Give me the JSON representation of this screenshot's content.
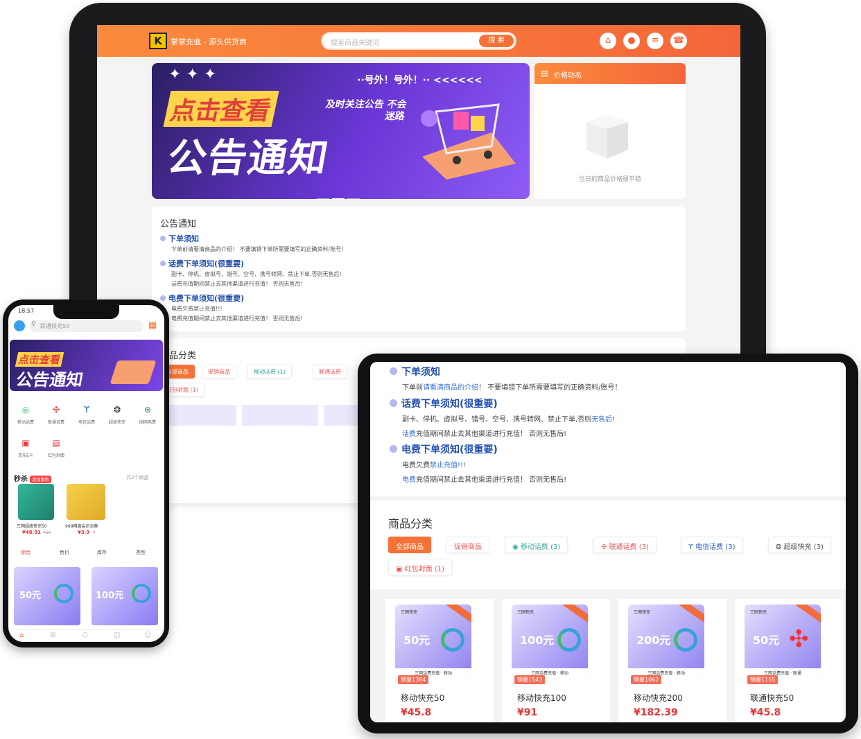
{
  "laptop": {
    "site_name": "掌掌充值 - 源头供货商",
    "logo_letter": "K",
    "search_placeholder": "搜索商品关键词",
    "search_button": "搜 索",
    "banner": {
      "top_text": "··号外！号外！·· <<<<<<",
      "headline": "点击查看",
      "subline": "及时关注公告 不会迷路",
      "big_title": "公告通知"
    },
    "price_card": {
      "title": "价格动态",
      "empty_note": "当日的商品价格很平稳"
    },
    "notice": {
      "title": "公告通知",
      "items": [
        {
          "title": "下单须知",
          "lines": [
            "下单前请看清商品的介绍！ 不要填错下单所需要填写的正确资料/账号！"
          ]
        },
        {
          "title": "话费下单须知(很重要)",
          "lines": [
            "副卡、停机、虚拟号、错号、空号、携号转网、禁止下单,否则无售后!",
            "话费充值期间禁止去其他渠道进行充值！ 否则无售后!"
          ]
        },
        {
          "title": "电费下单须知(很重要)",
          "lines": [
            "电费欠费禁止充值!!!",
            "电费充值期间禁止去其他渠道进行充值！ 否则无售后!"
          ]
        }
      ]
    },
    "category_title": "商品分类",
    "chips": [
      "全部商品",
      "促销商品",
      "移动话费 (1)",
      "联通话费"
    ],
    "chip_row2": "红包封面 (1)"
  },
  "phone": {
    "time": "18:57",
    "search_placeholder": "联通快充50",
    "icons": [
      "移动话费",
      "联通话费",
      "电信话费",
      "超级快充",
      "国网电费",
      "京东E卡",
      "红包封面"
    ],
    "seckill_title": "秒杀",
    "seckill_badge": "超值限购",
    "seckill_count": "共2个商品",
    "seckill_items": [
      {
        "name": "三网超级快充50",
        "price": "¥48.91",
        "old": "¥50"
      },
      {
        "name": "999网盘会员合集",
        "price": "¥3.9",
        "old": "¥"
      }
    ],
    "sorts": [
      "综合",
      "售价",
      "库存",
      "类型"
    ],
    "products": [
      {
        "amount": "50元"
      },
      {
        "amount": "100元"
      }
    ],
    "tabbar": [
      "首页",
      "分类",
      "订单",
      "购物车",
      "我的"
    ]
  },
  "tablet": {
    "notice": [
      {
        "title": "下单须知",
        "lines": [
          {
            "pre": "下单前",
            "link": "请看清商品的介绍",
            "post": "！ 不要填错下单所需要填写的正确资料/账号！"
          }
        ]
      },
      {
        "title": "话费下单须知(很重要)",
        "lines": [
          {
            "pre": "副卡、停机、虚拟号、错号、空号、携号转网、禁止下单,否则",
            "link": "无售后",
            "post": "!"
          },
          {
            "pre": "",
            "link": "话费",
            "post": "充值期间禁止去其他渠道进行充值！ 否则无售后!"
          }
        ]
      },
      {
        "title": "电费下单须知(很重要)",
        "lines": [
          {
            "pre": "电费欠费",
            "link": "禁止充值",
            "post": "!!!"
          },
          {
            "pre": "",
            "link": "电费",
            "post": "充值期间禁止去其他渠道进行充值！ 否则无售后!"
          }
        ]
      }
    ],
    "category_title": "商品分类",
    "chips": [
      "全部商品",
      "促销商品",
      "移动话费 (3)",
      "联通话费 (3)",
      "电信话费 (3)",
      "超级快充 (3)"
    ],
    "chip_row2": "红包封面 (1)",
    "cards": [
      {
        "brand": "三网快充",
        "amount": "50元",
        "foot": "三网话费充值 · 移动",
        "sold": "销量1384",
        "name": "移动快充50",
        "price": "¥45.8"
      },
      {
        "brand": "三网快充",
        "amount": "100元",
        "foot": "三网话费充值 · 移动",
        "sold": "销量1543",
        "name": "移动快充100",
        "price": "¥91"
      },
      {
        "brand": "三网快充",
        "amount": "200元",
        "foot": "三网话费充值 · 移动",
        "sold": "销量1062",
        "name": "移动快充200",
        "price": "¥182.39"
      },
      {
        "brand": "三网快充",
        "amount": "50元",
        "foot": "三网话费充值 · 联通",
        "sold": "销量1155",
        "name": "联通快充50",
        "price": "¥45.8"
      }
    ]
  },
  "colors": {
    "accent": "#f57236",
    "link": "#2350b0",
    "price": "#e33333"
  }
}
